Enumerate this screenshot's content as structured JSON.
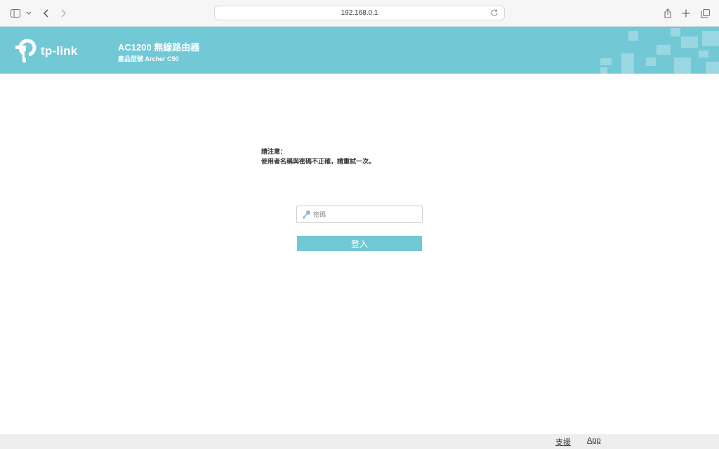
{
  "browser": {
    "url": "192.168.0.1",
    "icons": [
      "sidebar-icon",
      "chevron-down-icon",
      "back-icon",
      "forward-icon",
      "reload-icon",
      "share-icon",
      "new-tab-icon",
      "tabs-overview-icon"
    ]
  },
  "header": {
    "brand": "tp-link",
    "model_title": "AC1200 無線路由器",
    "model_subtitle": "產品型號 Archer C50",
    "background_color": "#73c8d6"
  },
  "notice": {
    "heading": "請注意：",
    "message": "使用者名稱與密碼不正確，請重試一次。"
  },
  "login": {
    "password_placeholder": "密碼",
    "password_value": "",
    "button_label": "登入",
    "accent_color": "#73c8d6"
  },
  "footer": {
    "support_label": "支援",
    "app_label": "App"
  }
}
